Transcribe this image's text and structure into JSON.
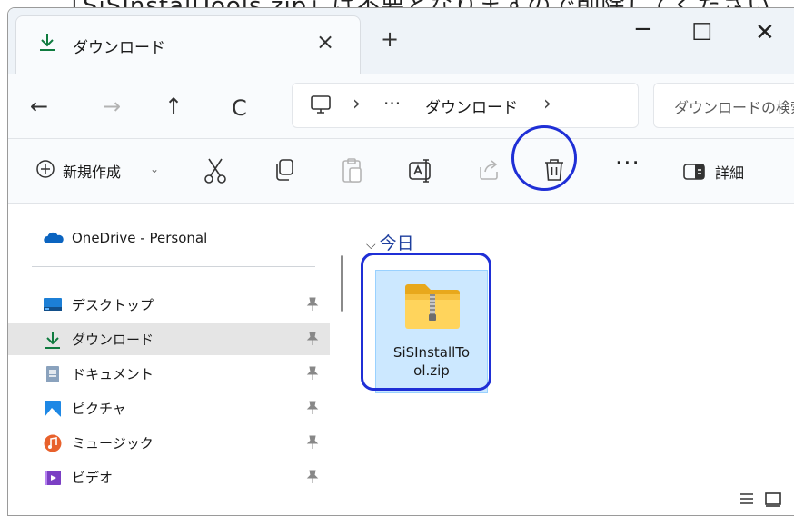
{
  "caption": "「SiSInstallTools.zip」は不要となりますので削除してください",
  "window": {
    "tab_title": "ダウンロード",
    "tab_close": "×",
    "new_tab": "+",
    "minimize": "−",
    "maximize": "☐",
    "close": "✕"
  },
  "navbar": {
    "back": "←",
    "forward": "→",
    "up": "↑",
    "refresh": "C",
    "breadcrumb_sep": "›",
    "breadcrumb_more": "···",
    "breadcrumb_current": "ダウンロード",
    "search_placeholder": "ダウンロードの検索"
  },
  "commandbar": {
    "new_label": "新規作成",
    "new_caret": "⌄",
    "more": "···",
    "details_label": "詳細"
  },
  "sidebar": {
    "onedrive": "OneDrive - Personal",
    "items": [
      {
        "label": "デスクトップ",
        "icon": "desktop-icon",
        "pinned": true
      },
      {
        "label": "ダウンロード",
        "icon": "download-icon",
        "pinned": true,
        "selected": true
      },
      {
        "label": "ドキュメント",
        "icon": "documents-icon",
        "pinned": true
      },
      {
        "label": "ピクチャ",
        "icon": "pictures-icon",
        "pinned": true
      },
      {
        "label": "ミュージック",
        "icon": "music-icon",
        "pinned": true
      },
      {
        "label": "ビデオ",
        "icon": "videos-icon",
        "pinned": true
      }
    ]
  },
  "content": {
    "group_chevron": "⌵",
    "group_header": "今日",
    "file_name": "SiSInstallTo\nol.zip"
  },
  "colors": {
    "accent": "#1f2fd6",
    "selection_bg": "#cce8ff",
    "download_green": "#0f7b3f"
  }
}
